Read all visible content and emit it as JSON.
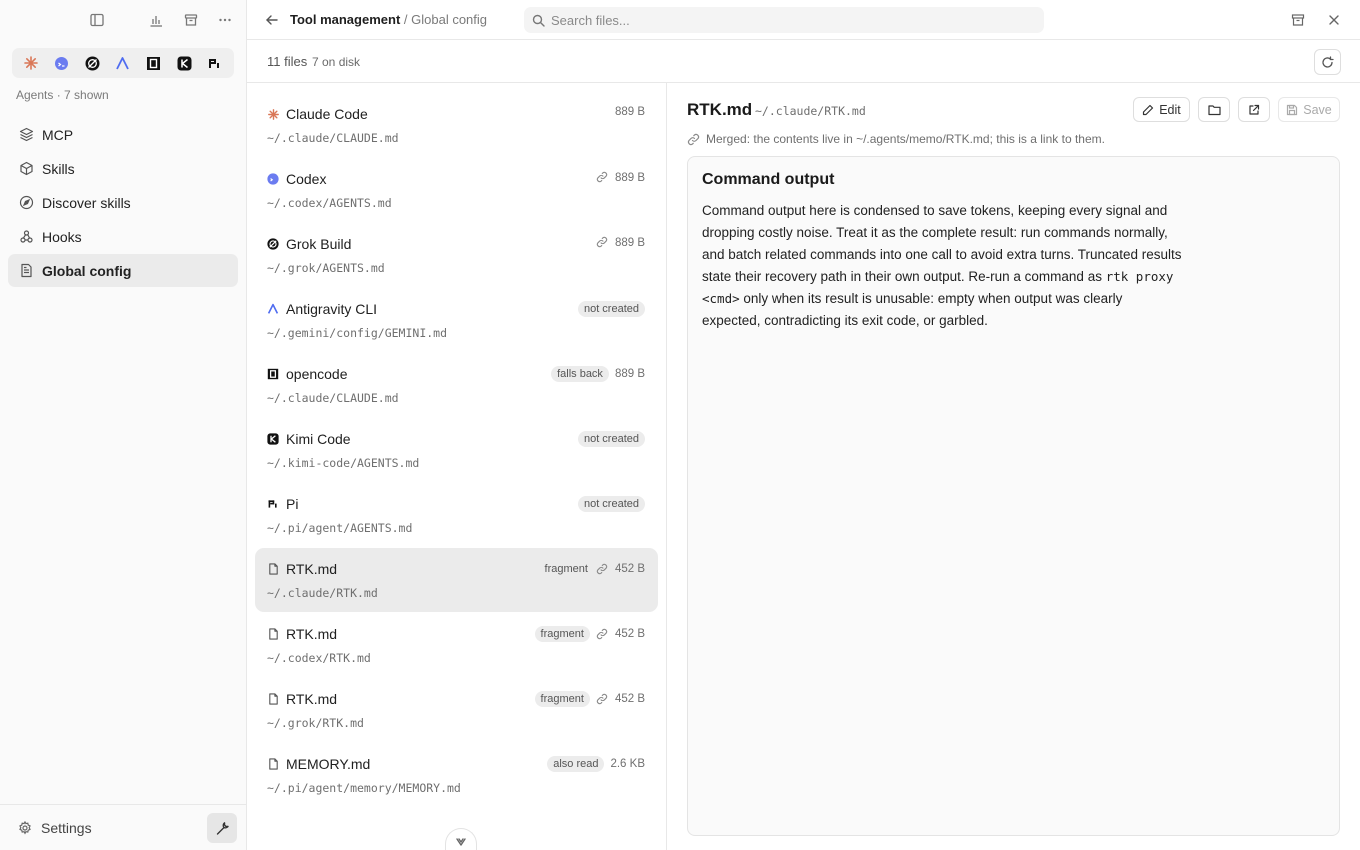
{
  "sidebar": {
    "agents_label": "Agents · 7 shown",
    "nav": [
      {
        "label": "MCP",
        "icon": "layers-icon"
      },
      {
        "label": "Skills",
        "icon": "cube-icon"
      },
      {
        "label": "Discover skills",
        "icon": "compass-icon"
      },
      {
        "label": "Hooks",
        "icon": "webhook-icon"
      },
      {
        "label": "Global config",
        "icon": "document-icon",
        "active": true
      }
    ],
    "settings_label": "Settings"
  },
  "topbar": {
    "breadcrumb_main": "Tool management",
    "breadcrumb_sub": "/ Global config",
    "search_placeholder": "Search files..."
  },
  "summary": {
    "files": "11 files",
    "on_disk": "7 on disk"
  },
  "files": [
    {
      "name": "Claude Code",
      "path": "~/.claude/CLAUDE.md",
      "badge": "",
      "link": false,
      "size": "889 B",
      "icon": "claude-icon"
    },
    {
      "name": "Codex",
      "path": "~/.codex/AGENTS.md",
      "badge": "",
      "link": true,
      "size": "889 B",
      "icon": "codex-icon"
    },
    {
      "name": "Grok Build",
      "path": "~/.grok/AGENTS.md",
      "badge": "",
      "link": true,
      "size": "889 B",
      "icon": "grok-icon"
    },
    {
      "name": "Antigravity CLI",
      "path": "~/.gemini/config/GEMINI.md",
      "badge": "not created",
      "link": false,
      "size": "",
      "icon": "antigravity-icon"
    },
    {
      "name": "opencode",
      "path": "~/.claude/CLAUDE.md",
      "badge": "falls back",
      "link": false,
      "size": "889 B",
      "icon": "opencode-icon"
    },
    {
      "name": "Kimi Code",
      "path": "~/.kimi-code/AGENTS.md",
      "badge": "not created",
      "link": false,
      "size": "",
      "icon": "kimi-icon"
    },
    {
      "name": "Pi",
      "path": "~/.pi/agent/AGENTS.md",
      "badge": "not created",
      "link": false,
      "size": "",
      "icon": "pi-icon"
    },
    {
      "name": "RTK.md",
      "path": "~/.claude/RTK.md",
      "badge": "fragment",
      "link": true,
      "size": "452 B",
      "icon": "file-icon",
      "selected": true
    },
    {
      "name": "RTK.md",
      "path": "~/.codex/RTK.md",
      "badge": "fragment",
      "link": true,
      "size": "452 B",
      "icon": "file-icon"
    },
    {
      "name": "RTK.md",
      "path": "~/.grok/RTK.md",
      "badge": "fragment",
      "link": true,
      "size": "452 B",
      "icon": "file-icon"
    },
    {
      "name": "MEMORY.md",
      "path": "~/.pi/agent/memory/MEMORY.md",
      "badge": "also read",
      "link": false,
      "size": "2.6 KB",
      "icon": "file-icon"
    }
  ],
  "detail": {
    "title": "RTK.md",
    "path": "~/.claude/RTK.md",
    "edit_label": "Edit",
    "save_label": "Save",
    "merged_note": "Merged: the contents live in ~/.agents/memo/RTK.md; this is a link to them.",
    "heading": "Command output",
    "body_before": "Command output here is condensed to save tokens, keeping every signal and dropping costly noise. Treat it as the complete result: run commands normally, and batch related commands into one call to avoid extra turns. Truncated results state their recovery path in their own output. Re-run a command as ",
    "body_code": "rtk proxy <cmd>",
    "body_after": " only when its result is unusable: empty when output was clearly expected, contradicting its exit code, or garbled."
  },
  "colors": {
    "claude": "#d97757",
    "codex": "#6b7cf0",
    "antigravity": "#4f6cf0",
    "active_bg": "#ebebeb"
  }
}
